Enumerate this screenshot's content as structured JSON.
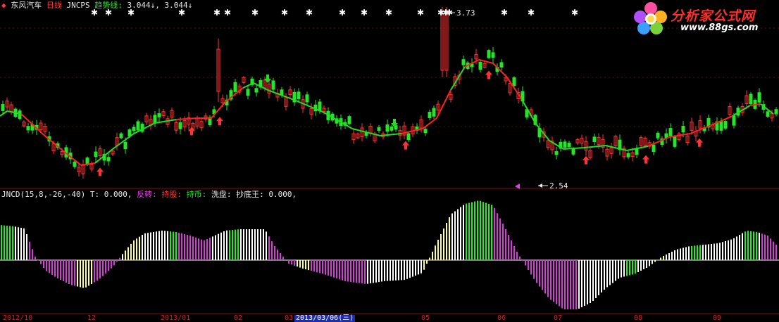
{
  "header": {
    "stock_name": "东风汽车",
    "period": "日线",
    "indicator": "JNCPS",
    "trend_label": "趋势线:",
    "trend_values": "3.044↓, 3.044↓"
  },
  "indicator_header": {
    "name": "JNCD(15,8,-26,-40)",
    "t_label": "T: 0.000,",
    "reversal": "反转:",
    "hold_stock": "持股:",
    "hold_market": "持币:",
    "wash": "洗盘:",
    "bottom_king": "抄底王: 0.000,"
  },
  "annotations": {
    "high_price": "3.73",
    "low_price": "2.54"
  },
  "logo": {
    "title": "分析家公式网",
    "url": "www.88gs.com"
  },
  "date_axis": [
    "2012/10",
    "12",
    "2013/01",
    "02",
    "03",
    "2013/03/06(三)",
    "05",
    "06",
    "07",
    "08",
    "09"
  ],
  "selected_date": "2013/03/06(三)",
  "colors": {
    "background": "#000000",
    "candle_up": "#ff3333",
    "candle_down": "#27e32c",
    "trend_up": "#ff2222",
    "trend_down": "#22dd22",
    "hist_white": "#ffffff",
    "hist_magenta": "#d040d0",
    "hist_yellow": "#ffff80",
    "hist_green": "#22ee22",
    "gridline": "#7a1010",
    "buy_arrow": "#ff3333"
  },
  "icons": {
    "buy_signal": "up-arrow-icon",
    "sell_signal": "down-arrow-icon",
    "signal_marker": "star-icon",
    "cursor_marker": "left-triangle-icon"
  }
}
